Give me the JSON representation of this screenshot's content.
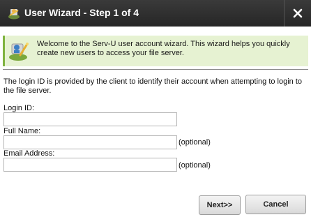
{
  "window": {
    "title": "User Wizard - Step 1 of 4",
    "title_icon": "user-wizard-icon",
    "close_icon": "close-icon",
    "titlebar_color": "#2e2e2e"
  },
  "banner": {
    "icon": "user-wizard-icon",
    "text": "Welcome to the Serv-U user account wizard. This wizard helps you quickly create new users to access your file server.",
    "background": "#e6f2d2",
    "accent": "#7fb33f"
  },
  "intro": "The login ID is provided by the client to identify their account when attempting to login to the file server.",
  "form": {
    "login_id": {
      "label": "Login ID:",
      "value": "",
      "optional_label": ""
    },
    "full_name": {
      "label": "Full Name:",
      "value": "",
      "optional_label": "(optional)"
    },
    "email": {
      "label": "Email Address:",
      "value": "",
      "optional_label": "(optional)"
    }
  },
  "buttons": {
    "next": "Next>>",
    "cancel": "Cancel"
  }
}
